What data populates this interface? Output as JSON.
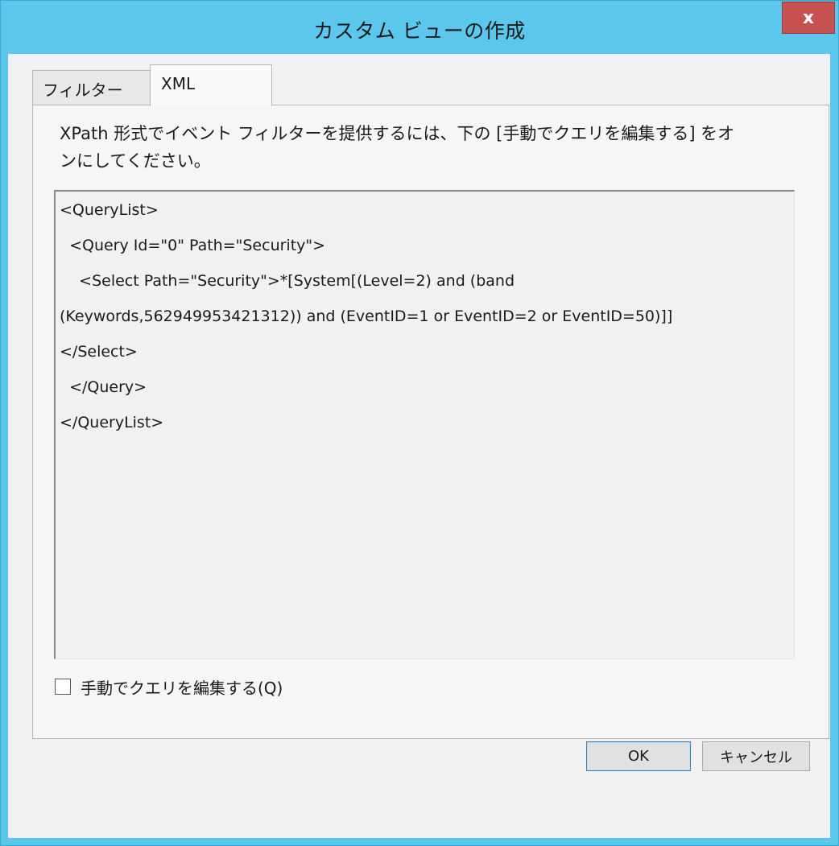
{
  "window": {
    "title": "カスタム ビューの作成",
    "close_label": "x"
  },
  "tabs": [
    {
      "label": "フィルター",
      "selected": false
    },
    {
      "label": "XML",
      "selected": true
    }
  ],
  "xml_tab": {
    "description_line1": "XPath 形式でイベント フィルターを提供するには、下の [手動でクエリを編集する] をオ",
    "description_line2": "ンにしてください。",
    "query_lines": [
      "<QueryList>",
      "  <Query Id=\"0\" Path=\"Security\">",
      "    <Select Path=\"Security\">*[System[(Level=2) and (band",
      "(Keywords,562949953421312)) and (EventID=1 or EventID=2 or EventID=50)]]",
      "</Select>",
      "  </Query>",
      "</QueryList>"
    ],
    "manual_edit_label": "手動でクエリを編集する(Q)",
    "manual_edit_checked": false
  },
  "buttons": {
    "ok": "OK",
    "cancel": "キャンセル"
  },
  "colors": {
    "title_bar": "#5bc7ec",
    "close_button": "#c75050",
    "dialog_background": "#f1f0f2"
  }
}
